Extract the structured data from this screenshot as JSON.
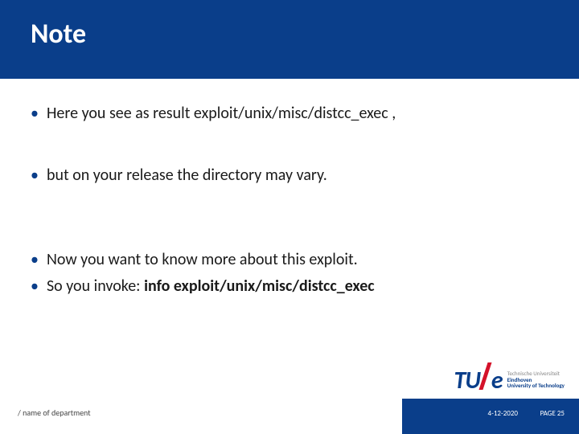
{
  "header": {
    "title": "Note"
  },
  "bullets": {
    "b1": "Here you see as result exploit/unix/misc/distcc_exec ,",
    "b2": "but on your release the directory may vary.",
    "b3": "Now you want to know more about this exploit.",
    "b4_prefix": "So you invoke: ",
    "b4_bold": "info exploit/unix/misc/distcc_exec"
  },
  "logo": {
    "mark_left": "TU",
    "mark_right": "e",
    "line1": "Technische Universiteit",
    "line2": "Eindhoven",
    "line3": "University of Technology"
  },
  "footer": {
    "dept": "/ name of department",
    "date": "4-12-2020",
    "page": "PAGE 25"
  }
}
